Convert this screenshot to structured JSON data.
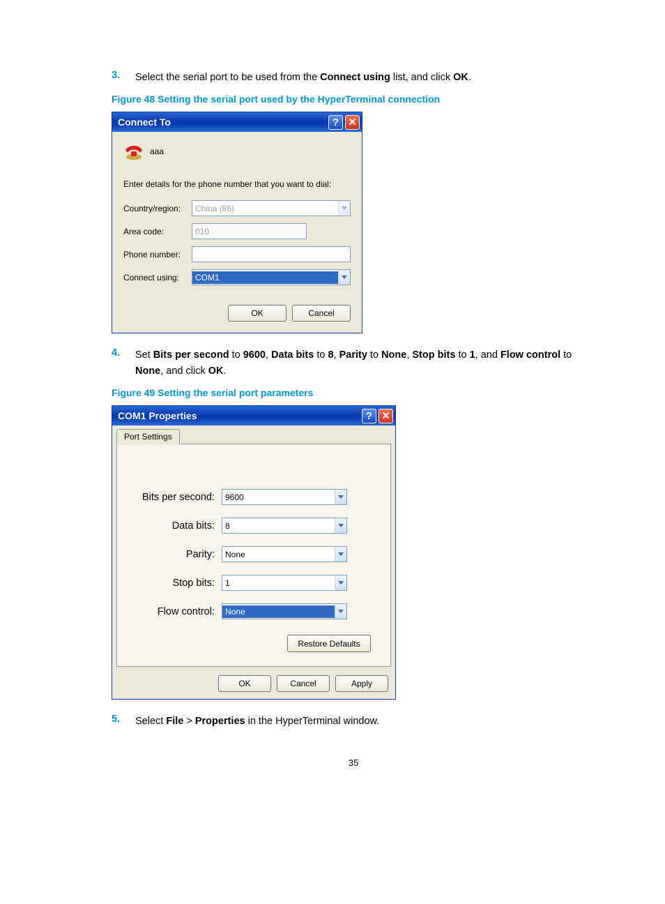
{
  "step3": {
    "num": "3.",
    "t1": "Select the serial port to be used from the ",
    "b1": "Connect using",
    "t2": " list, and click ",
    "b2": "OK",
    "t3": "."
  },
  "fig48_caption": "Figure 48 Setting the serial port used by the HyperTerminal connection",
  "dlg1": {
    "title": "Connect To",
    "icon_label": "aaa",
    "prompt": "Enter details for the phone number that you want to dial:",
    "country_label": "Country/region:",
    "country_value": "China (86)",
    "area_label": "Area code:",
    "area_value": "010",
    "phone_label": "Phone number:",
    "phone_value": "",
    "connect_label": "Connect using:",
    "connect_value": "COM1",
    "ok": "OK",
    "cancel": "Cancel"
  },
  "step4": {
    "num": "4.",
    "t1": "Set ",
    "b1": "Bits per second",
    "t2": " to ",
    "b2": "9600",
    "t3": ", ",
    "b3": "Data bits",
    "t4": " to ",
    "b4": "8",
    "t5": ", ",
    "b5": "Parity",
    "t6": " to ",
    "b6": "None",
    "t7": ", ",
    "b7": "Stop bits",
    "t8": " to ",
    "b8": "1",
    "t9": ", and ",
    "b9": "Flow control",
    "t10": " to ",
    "b10": "None",
    "t11": ", and click ",
    "b11": "OK",
    "t12": "."
  },
  "fig49_caption": "Figure 49 Setting the serial port parameters",
  "dlg2": {
    "title": "COM1 Properties",
    "tab": "Port Settings",
    "bps_label": "Bits per second:",
    "bps_value": "9600",
    "databits_label": "Data bits:",
    "databits_value": "8",
    "parity_label": "Parity:",
    "parity_value": "None",
    "stopbits_label": "Stop bits:",
    "stopbits_value": "1",
    "flow_label": "Flow control:",
    "flow_value": "None",
    "restore": "Restore Defaults",
    "ok": "OK",
    "cancel": "Cancel",
    "apply": "Apply"
  },
  "step5": {
    "num": "5.",
    "t1": "Select ",
    "b1": "File",
    "t2": " > ",
    "b2": "Properties",
    "t3": " in the HyperTerminal window."
  },
  "page_number": "35"
}
